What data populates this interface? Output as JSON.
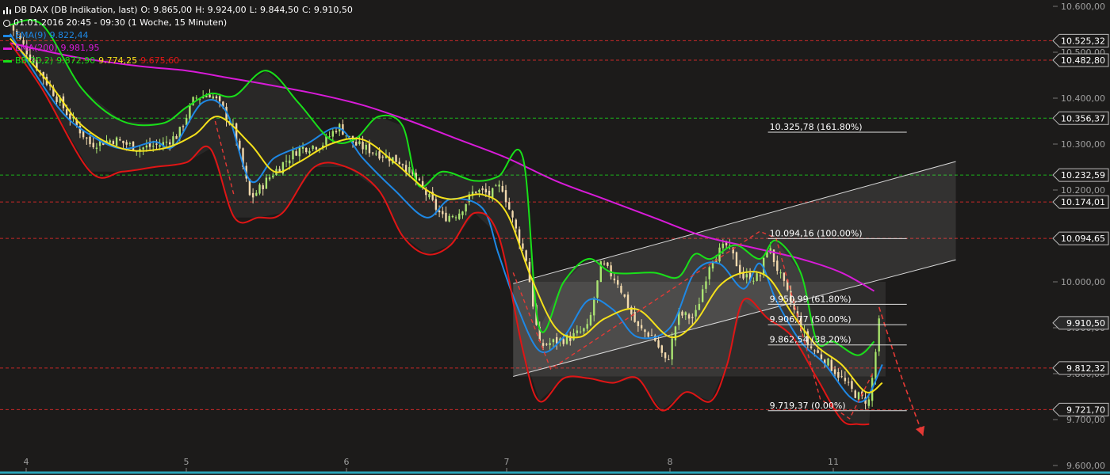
{
  "legend": {
    "instrument": "DB DAX (DB Indikation, last)",
    "open": "O: 9.865,00",
    "high": "H: 9.924,00",
    "low": "L: 9.844,50",
    "close": "C: 9.910,50",
    "period": "01.01.2016 20:45 - 09:30 (1 Woche, 15 Minuten)",
    "ema9_label": "EMA(9)",
    "ema9_value": "9.822,44",
    "ema200_label": "EMA(200)",
    "ema200_value": "9.981,95",
    "bb_label": "BB(20,2)",
    "bb_upper": "9.872,90",
    "bb_mid": "9.774,25",
    "bb_lower": "9.675,60"
  },
  "colors": {
    "background": "#1c1b1a",
    "ema9": "#1e88e5",
    "ema200": "#d81bd8",
    "bb_upper": "#19e019",
    "bb_mid": "#f5e11b",
    "bb_lower": "#e01515",
    "candle_up": "#a6e36a",
    "candle_down": "#f2d7a8",
    "support_line": "#c62828",
    "resistance_line": "#1bb51b",
    "projection": "#e53935",
    "channel": "#d8d8d8"
  },
  "chart_data": {
    "type": "candlestick",
    "instrument": "DB DAX",
    "y_axis": {
      "ylim": [
        9600,
        10600
      ],
      "ticks": [
        "10.600,00",
        "10.500,00",
        "10.400,00",
        "10.300,00",
        "10.200,00",
        "10.000,00",
        "9.900,00",
        "9.800,00",
        "9.700,00",
        "9.600,00"
      ],
      "tick_values": [
        10600,
        10500,
        10400,
        10300,
        10200,
        10000,
        9900,
        9800,
        9700,
        9600
      ]
    },
    "x_axis": {
      "ticks": [
        "4",
        "5",
        "6",
        "7",
        "8",
        "11"
      ],
      "tick_index": [
        0,
        1,
        2,
        3,
        4,
        5
      ],
      "xlim": [
        -0.15,
        5.75
      ]
    },
    "price_lines": [
      {
        "label": "10.525,32",
        "value": 10525.32,
        "color": "#c62828"
      },
      {
        "label": "10.482,80",
        "value": 10482.8,
        "color": "#c62828"
      },
      {
        "label": "10.356,37",
        "value": 10356.37,
        "color": "#1bb51b"
      },
      {
        "label": "10.232,59",
        "value": 10232.59,
        "color": "#1bb51b"
      },
      {
        "label": "10.174,01",
        "value": 10174.01,
        "color": "#c62828"
      },
      {
        "label": "10.094,65",
        "value": 10094.65,
        "color": "#c62828"
      },
      {
        "label": "9.812,32",
        "value": 9812.32,
        "color": "#c62828"
      },
      {
        "label": "9.721,70",
        "value": 9721.7,
        "color": "#c62828"
      }
    ],
    "last_price": {
      "label": "9.910,50",
      "value": 9910.5
    },
    "fibonacci": {
      "x_start": 4.6,
      "x_end": 5.45,
      "levels": [
        {
          "label": "10.325,78 (161.80%)",
          "value": 10325.78
        },
        {
          "label": "10.094,16 (100.00%)",
          "value": 10094.16
        },
        {
          "label": "9.950,99 (61.80%)",
          "value": 9950.99
        },
        {
          "label": "9.906,77 (50.00%)",
          "value": 9906.77
        },
        {
          "label": "9.862,54 (38.20%)",
          "value": 9862.54
        },
        {
          "label": "9.719,37 (0.00%)",
          "value": 9719.37
        }
      ]
    },
    "channel": {
      "lower": [
        [
          3.04,
          9794
        ],
        [
          5.75,
          10048
        ]
      ],
      "upper": [
        [
          3.04,
          9996
        ],
        [
          5.75,
          10262
        ]
      ]
    },
    "shaded_range": {
      "x": [
        3.04,
        5.32
      ],
      "y": [
        9794,
        10000
      ]
    },
    "projection": [
      [
        5.28,
        9945
      ],
      [
        5.42,
        9790
      ],
      [
        5.55,
        9665
      ]
    ],
    "zigzag": [
      [
        3.04,
        10020
      ],
      [
        3.27,
        9810
      ],
      [
        4.55,
        10110
      ],
      [
        4.65,
        10095
      ],
      [
        4.92,
        9745
      ],
      [
        5.1,
        9702
      ],
      [
        5.24,
        9800
      ]
    ],
    "early_zigzag": [
      [
        1.18,
        10350
      ],
      [
        1.3,
        10185
      ]
    ],
    "series": [
      {
        "name": "EMA(9)",
        "color": "#1e88e5",
        "x": [
          -0.1,
          0.2,
          0.4,
          0.6,
          0.8,
          0.92,
          1.1,
          1.25,
          1.4,
          1.55,
          1.75,
          1.95,
          2.1,
          2.3,
          2.5,
          2.65,
          2.85,
          2.95,
          3.05,
          3.2,
          3.35,
          3.5,
          3.65,
          3.8,
          4.0,
          4.15,
          4.3,
          4.45,
          4.55,
          4.65,
          4.8,
          4.95,
          5.1,
          5.2,
          5.3
        ],
        "y": [
          10540,
          10380,
          10320,
          10290,
          10305,
          10295,
          10390,
          10370,
          10220,
          10270,
          10300,
          10335,
          10270,
          10200,
          10140,
          10180,
          10160,
          10060,
          9960,
          9850,
          9880,
          9960,
          9940,
          9880,
          9900,
          10020,
          10040,
          9985,
          10040,
          9960,
          9870,
          9820,
          9750,
          9745,
          9820
        ]
      },
      {
        "name": "EMA(200)",
        "color": "#d81bd8",
        "x": [
          -0.1,
          0.3,
          0.7,
          1.0,
          1.25,
          1.5,
          1.8,
          2.1,
          2.4,
          2.7,
          3.0,
          3.3,
          3.6,
          3.9,
          4.2,
          4.5,
          4.8,
          5.05,
          5.25
        ],
        "y": [
          10520,
          10490,
          10470,
          10460,
          10445,
          10430,
          10410,
          10385,
          10350,
          10310,
          10270,
          10220,
          10180,
          10140,
          10100,
          10075,
          10050,
          10020,
          9980
        ]
      },
      {
        "name": "BB(20,2) upper",
        "color": "#19e019",
        "x": [
          -0.1,
          0.1,
          0.35,
          0.6,
          0.85,
          1.0,
          1.15,
          1.3,
          1.5,
          1.7,
          1.9,
          2.05,
          2.2,
          2.35,
          2.45,
          2.6,
          2.8,
          2.95,
          3.1,
          3.2,
          3.35,
          3.5,
          3.65,
          3.9,
          4.05,
          4.15,
          4.25,
          4.4,
          4.55,
          4.65,
          4.8,
          4.9,
          5.0,
          5.15,
          5.25
        ],
        "y": [
          10560,
          10560,
          10420,
          10350,
          10345,
          10380,
          10410,
          10405,
          10460,
          10390,
          10310,
          10310,
          10360,
          10340,
          10210,
          10240,
          10220,
          10230,
          10270,
          9900,
          10000,
          10050,
          10020,
          10020,
          10010,
          10060,
          10050,
          10080,
          10050,
          10090,
          10020,
          9870,
          9870,
          9840,
          9870
        ]
      },
      {
        "name": "BB(20,2) middle",
        "color": "#f5e11b",
        "x": [
          -0.1,
          0.15,
          0.35,
          0.6,
          0.85,
          1.05,
          1.2,
          1.4,
          1.55,
          1.7,
          1.9,
          2.1,
          2.3,
          2.5,
          2.65,
          2.85,
          3.0,
          3.15,
          3.3,
          3.45,
          3.6,
          3.8,
          4.0,
          4.15,
          4.3,
          4.45,
          4.6,
          4.75,
          4.9,
          5.05,
          5.2,
          5.3
        ],
        "y": [
          10530,
          10430,
          10340,
          10290,
          10290,
          10320,
          10360,
          10300,
          10240,
          10260,
          10300,
          10310,
          10260,
          10200,
          10180,
          10190,
          10150,
          10010,
          9900,
          9880,
          9920,
          9940,
          9880,
          9910,
          9990,
          10020,
          10010,
          9930,
          9860,
          9820,
          9760,
          9780
        ]
      },
      {
        "name": "BB(20,2) lower",
        "color": "#e01515",
        "x": [
          -0.1,
          0.1,
          0.4,
          0.6,
          0.8,
          1.0,
          1.15,
          1.3,
          1.45,
          1.6,
          1.8,
          2.0,
          2.2,
          2.35,
          2.5,
          2.65,
          2.8,
          2.95,
          3.1,
          3.2,
          3.35,
          3.5,
          3.65,
          3.8,
          3.95,
          4.1,
          4.25,
          4.35,
          4.45,
          4.6,
          4.75,
          4.9,
          5.05,
          5.15,
          5.22
        ],
        "y": [
          10520,
          10420,
          10240,
          10240,
          10250,
          10260,
          10290,
          10140,
          10140,
          10150,
          10250,
          10250,
          10200,
          10100,
          10060,
          10080,
          10150,
          10100,
          9850,
          9740,
          9790,
          9790,
          9780,
          9790,
          9720,
          9760,
          9740,
          9820,
          9960,
          9920,
          9880,
          9790,
          9700,
          9690,
          9690
        ]
      }
    ],
    "candles_path": {
      "x": [
        -0.1,
        0.1,
        0.25,
        0.4,
        0.55,
        0.7,
        0.85,
        0.95,
        1.05,
        1.15,
        1.2,
        1.3,
        1.4,
        1.55,
        1.7,
        1.85,
        1.95,
        2.05,
        2.2,
        2.35,
        2.5,
        2.6,
        2.7,
        2.8,
        2.9,
        2.97,
        3.05,
        3.12,
        3.2,
        3.3,
        3.4,
        3.5,
        3.58,
        3.68,
        3.8,
        3.9,
        3.98,
        4.05,
        4.15,
        4.25,
        4.35,
        4.45,
        4.55,
        4.6,
        4.7,
        4.78,
        4.85,
        4.95,
        5.05,
        5.12,
        5.18,
        5.22,
        5.25,
        5.28
      ],
      "y": [
        10560,
        10450,
        10370,
        10300,
        10310,
        10290,
        10300,
        10320,
        10400,
        10410,
        10390,
        10330,
        10180,
        10240,
        10290,
        10300,
        10340,
        10300,
        10280,
        10260,
        10190,
        10140,
        10150,
        10200,
        10190,
        10210,
        10120,
        10050,
        9860,
        9870,
        9880,
        9900,
        10040,
        10000,
        9900,
        9880,
        9820,
        9930,
        9920,
        10050,
        10080,
        10010,
        10010,
        10080,
        9990,
        9920,
        9860,
        9830,
        9790,
        9760,
        9745,
        9740,
        9820,
        9910
      ]
    }
  }
}
